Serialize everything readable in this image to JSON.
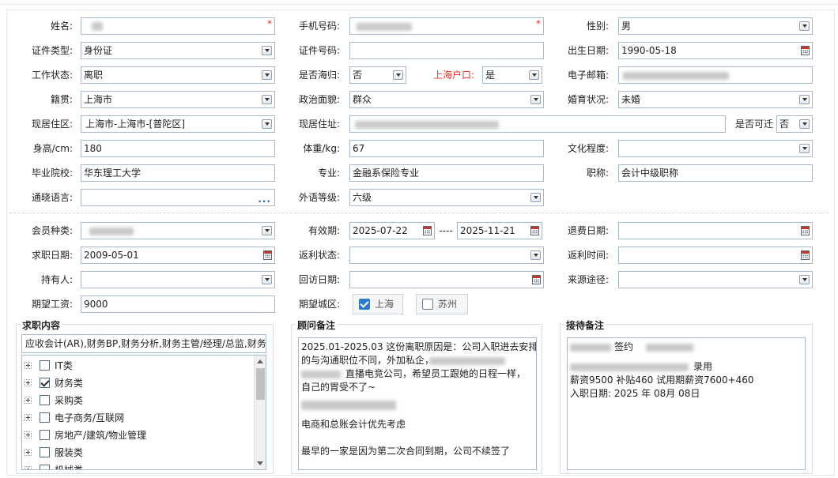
{
  "form": {
    "name": {
      "label": "姓名:",
      "required_mark": "*"
    },
    "phone": {
      "label": "手机号码:",
      "required_mark": "*"
    },
    "gender": {
      "label": "性别:",
      "value": "男"
    },
    "id_type": {
      "label": "证件类型:",
      "value": "身份证"
    },
    "id_number": {
      "label": "证件号码:",
      "value": ""
    },
    "birth_date": {
      "label": "出生日期:",
      "value": "1990-05-18"
    },
    "work_status": {
      "label": "工作状态:",
      "value": "离职"
    },
    "returnee": {
      "label": "是否海归:",
      "value": "否"
    },
    "sh_hukou": {
      "label": "上海户口:",
      "value": "是"
    },
    "email": {
      "label": "电子邮箱:"
    },
    "native_place": {
      "label": "籍贯:",
      "value": "上海市"
    },
    "political": {
      "label": "政治面貌:",
      "value": "群众"
    },
    "marital": {
      "label": "婚育状况:",
      "value": "未婚"
    },
    "residence": {
      "label": "现居住区:",
      "value": "上海市-上海市-[普陀区]"
    },
    "address": {
      "label": "现居住址:"
    },
    "relocate": {
      "label": "是否可迁",
      "value": "否"
    },
    "height": {
      "label": "身高/cm:",
      "value": "180"
    },
    "weight": {
      "label": "体重/kg:",
      "value": "67"
    },
    "education": {
      "label": "文化程度:",
      "value": ""
    },
    "school": {
      "label": "毕业院校:",
      "value": "华东理工大学"
    },
    "major": {
      "label": "专业:",
      "value": "金融系保险专业"
    },
    "title": {
      "label": "职称:",
      "value": "会计中级职称"
    },
    "languages": {
      "label": "通晓语言:",
      "value": "",
      "more_icon": "..."
    },
    "foreign_level": {
      "label": "外语等级:",
      "value": "六级"
    },
    "member_type": {
      "label": "会员种类:"
    },
    "valid_period": {
      "label": "有效期:",
      "from": "2025-07-22",
      "separator": "----",
      "to": "2025-11-21"
    },
    "refund_date": {
      "label": "退费日期:",
      "value": ""
    },
    "job_date": {
      "label": "求职日期:",
      "value": "2009-05-01"
    },
    "rebate_status": {
      "label": "返利状态:",
      "value": ""
    },
    "rebate_time": {
      "label": "返利时间:",
      "value": ""
    },
    "holder": {
      "label": "持有人:",
      "value": ""
    },
    "visit_date": {
      "label": "回访日期:",
      "value": ""
    },
    "source": {
      "label": "来源途径:",
      "value": ""
    },
    "salary": {
      "label": "期望工资:",
      "value": "9000"
    },
    "city": {
      "label": "期望城区:",
      "options": [
        {
          "label": "上海",
          "checked": true
        },
        {
          "label": "苏州",
          "checked": false
        }
      ]
    }
  },
  "job_content": {
    "title": "求职内容",
    "selected_summary": "应收会计(AR),财务BP,财务分析,财务主管/经理/总监,财务",
    "tree": [
      {
        "label": "IT类",
        "checked": false
      },
      {
        "label": "财务类",
        "checked": true
      },
      {
        "label": "采购类",
        "checked": false
      },
      {
        "label": "电子商务/互联网",
        "checked": false
      },
      {
        "label": "房地产/建筑/物业管理",
        "checked": false
      },
      {
        "label": "服装类",
        "checked": false
      },
      {
        "label": "机械类",
        "checked": false
      }
    ]
  },
  "advisor_notes": {
    "title": "顾问备注",
    "lines": [
      "2025.01-2025.03 这份离职原因是：公司入职进去安排",
      "的与沟通职位不同，外加私企，",
      "直播电竞公司，希望员工跟她的日程一样，",
      "自己的胃受不了~",
      "",
      "电商和总账会计优先考虑",
      "",
      "最早的一家是因为第二次合同到期，公司不续签了"
    ]
  },
  "reception_notes": {
    "title": "接待备注",
    "sign_text": "签约",
    "hired_text": "录用",
    "salary_line": "薪资9500  补贴460 试用期薪资7600+460",
    "entry_line": "入职日期:  2025 年 08月 08日"
  },
  "colors": {
    "required": "#e0302a",
    "border": "#a9b8c7",
    "checkbox_on": "#2d7ac9"
  }
}
